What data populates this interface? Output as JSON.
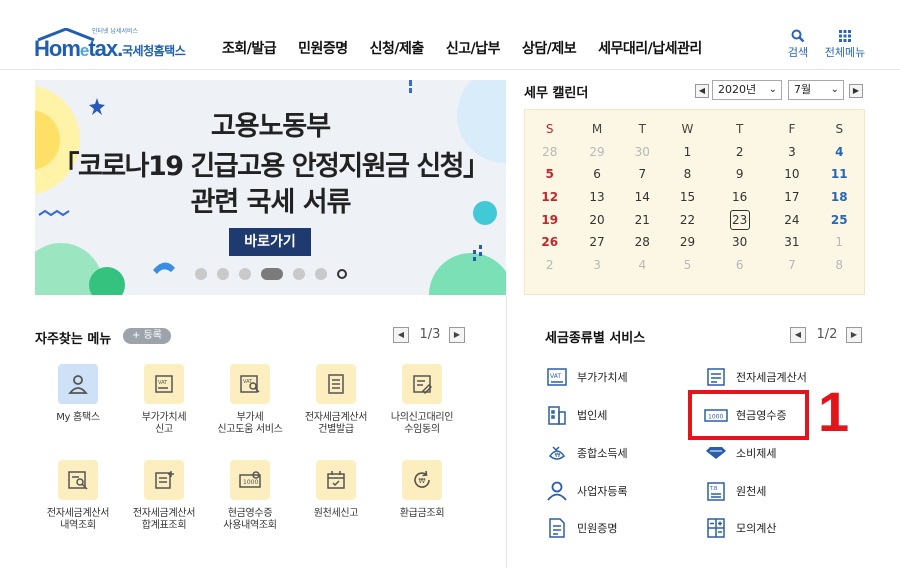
{
  "header": {
    "logo_tagline": "인터넷 납세서비스",
    "logo_word_a": "Hom",
    "logo_word_e": "e",
    "logo_word_b": "tax.",
    "logo_kr": "국세청홈택스",
    "nav": [
      "조회/발급",
      "민원증명",
      "신청/제출",
      "신고/납부",
      "상담/제보",
      "세무대리/납세관리"
    ],
    "search_label": "검색",
    "all_menu_label": "전체메뉴"
  },
  "banner": {
    "line1": "고용노동부",
    "line2": "「코로나19 긴급고용 안정지원금 신청」",
    "line3": "관련 국세 서류",
    "button": "바로가기",
    "slide_count": 7,
    "active_slide": 4
  },
  "calendar": {
    "title": "세무 캘린더",
    "year": "2020년",
    "month": "7월",
    "weekdays": [
      "S",
      "M",
      "T",
      "W",
      "T",
      "F",
      "S"
    ],
    "weeks": [
      [
        "28",
        "29",
        "30",
        "1",
        "2",
        "3",
        "4"
      ],
      [
        "5",
        "6",
        "7",
        "8",
        "9",
        "10",
        "11"
      ],
      [
        "12",
        "13",
        "14",
        "15",
        "16",
        "17",
        "18"
      ],
      [
        "19",
        "20",
        "21",
        "22",
        "23",
        "24",
        "25"
      ],
      [
        "26",
        "27",
        "28",
        "29",
        "30",
        "31",
        "1"
      ],
      [
        "2",
        "3",
        "4",
        "5",
        "6",
        "7",
        "8"
      ]
    ],
    "today": "23"
  },
  "favorites": {
    "title": "자주찾는 메뉴",
    "register": "+ 등록",
    "page": "1/3",
    "items": [
      {
        "label": "My 홈택스",
        "icon": "person-icon"
      },
      {
        "label": "부가가치세\n신고",
        "icon": "vat-document-icon"
      },
      {
        "label": "부가세\n신고도움 서비스",
        "icon": "vat-search-icon"
      },
      {
        "label": "전자세금계산서\n건별발급",
        "icon": "invoice-icon"
      },
      {
        "label": "나의신고대리인\n수임동의",
        "icon": "agent-consent-icon"
      },
      {
        "label": "전자세금계산서\n내역조회",
        "icon": "invoice-search-icon"
      },
      {
        "label": "전자세금계산서\n합계표조회",
        "icon": "invoice-summary-icon"
      },
      {
        "label": "현금영수증\n사용내역조회",
        "icon": "cash-receipt-icon"
      },
      {
        "label": "원천세신고",
        "icon": "withholding-calendar-icon"
      },
      {
        "label": "환급금조회",
        "icon": "refund-icon"
      }
    ]
  },
  "tax_services": {
    "title": "세금종류별 서비스",
    "page": "1/2",
    "items": [
      {
        "label": "부가가치세",
        "icon": "vat-icon"
      },
      {
        "label": "전자세금계산서",
        "icon": "e-invoice-icon"
      },
      {
        "label": "법인세",
        "icon": "corporate-building-icon"
      },
      {
        "label": "현금영수증",
        "icon": "cash-bill-icon"
      },
      {
        "label": "종합소득세",
        "icon": "income-tax-icon"
      },
      {
        "label": "소비제세",
        "icon": "diamond-icon"
      },
      {
        "label": "사업자등록",
        "icon": "business-person-icon"
      },
      {
        "label": "원천세",
        "icon": "withholding-tax-icon"
      },
      {
        "label": "민원증명",
        "icon": "certificate-icon"
      },
      {
        "label": "모의계산",
        "icon": "calculator-icon"
      }
    ]
  },
  "annotation": {
    "number": "1",
    "color": "#e3141a"
  },
  "colors": {
    "brand": "#1e5fb3",
    "banner_button": "#1f3a6e",
    "calendar_bg": "#fbf7e4",
    "sunday": "#c0282d",
    "saturday": "#2866b8"
  }
}
